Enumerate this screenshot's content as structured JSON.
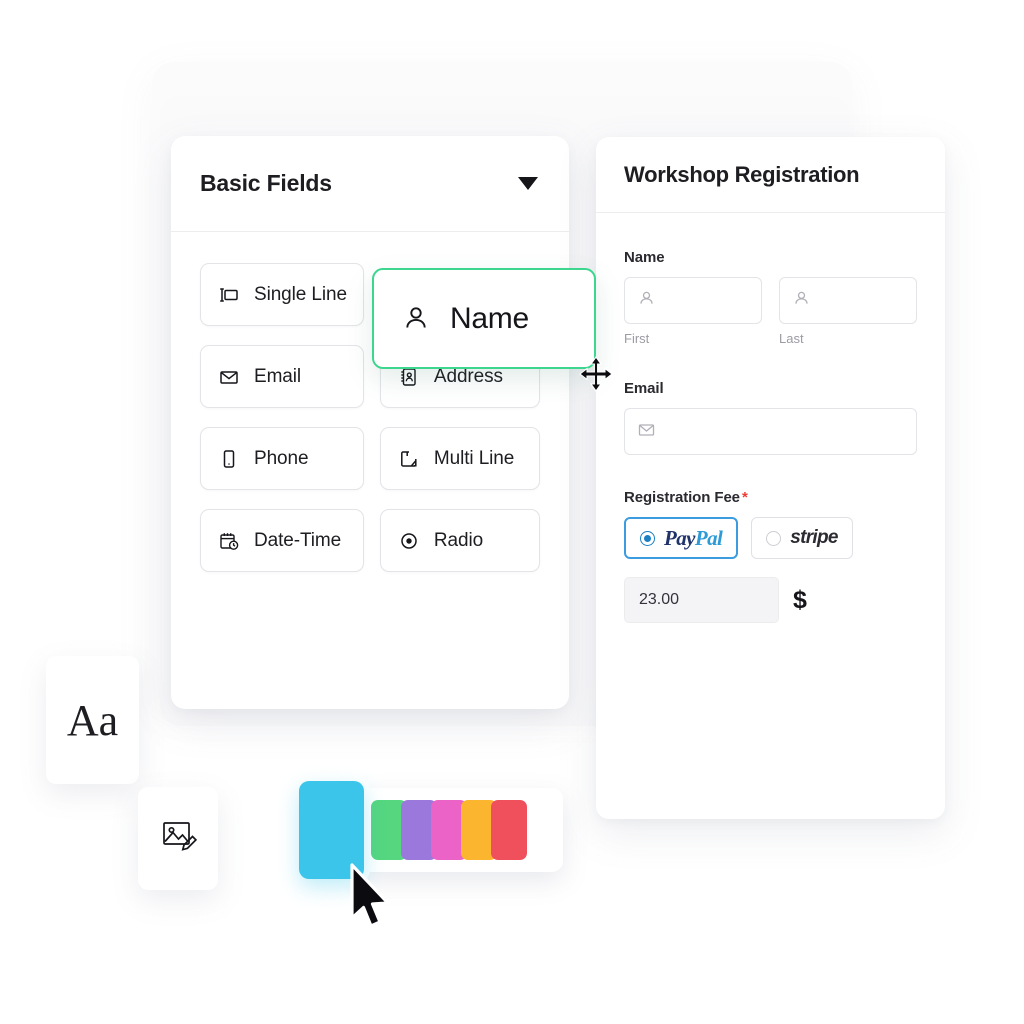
{
  "panels": {
    "fields": {
      "header_title": "Basic Fields",
      "chevron_icon": "chevron-down-icon",
      "items": [
        {
          "label": "Single Line",
          "icon": "single-line-icon"
        },
        {
          "label": "Email",
          "icon": "envelope-icon"
        },
        {
          "label": "Address",
          "icon": "address-book-icon"
        },
        {
          "label": "Phone",
          "icon": "phone-icon"
        },
        {
          "label": "Multi Line",
          "icon": "multi-line-icon"
        },
        {
          "label": "Date-Time",
          "icon": "calendar-clock-icon"
        },
        {
          "label": "Radio",
          "icon": "radio-button-icon"
        }
      ],
      "dragging_chip": {
        "label": "Name",
        "icon": "user-icon",
        "border_color": "#3cd68e",
        "state": "dragging"
      },
      "move_cursor_icon": "move-four-arrows-cursor"
    },
    "form": {
      "title": "Workshop Registration",
      "sections": [
        {
          "label": "Name",
          "required": false,
          "inputs": [
            {
              "icon": "user-icon",
              "value": "",
              "sub_label": "First"
            },
            {
              "icon": "user-icon",
              "value": "",
              "sub_label": "Last"
            }
          ]
        },
        {
          "label": "Email",
          "required": false,
          "inputs": [
            {
              "icon": "envelope-icon",
              "value": "",
              "sub_label": ""
            }
          ]
        }
      ],
      "payment": {
        "label": "Registration Fee",
        "required": true,
        "required_marker": "*",
        "required_color": "#ee3b35",
        "options": [
          {
            "name": "PayPal",
            "logo_part_1": "Pay",
            "logo_part_2": "Pal",
            "selected": true,
            "border_color": "#3b9ce0"
          },
          {
            "name": "stripe",
            "logo_part_1": "stripe",
            "logo_part_2": "",
            "selected": false,
            "border_color": "#e0e1e5"
          }
        ],
        "amount_value": "23.00",
        "currency_symbol": "$"
      }
    }
  },
  "tools": {
    "typography_card": {
      "label": "Aa",
      "icon": "typography-icon"
    },
    "image_card": {
      "icon": "image-edit-icon"
    }
  },
  "palette": {
    "active_swatch": {
      "name": "cyan",
      "color": "#3bc5ea",
      "selected": true
    },
    "swatches": [
      {
        "name": "green",
        "color": "#55d67f"
      },
      {
        "name": "purple",
        "color": "#9a78dc"
      },
      {
        "name": "pink",
        "color": "#ec63c8"
      },
      {
        "name": "orange",
        "color": "#fcb52e"
      },
      {
        "name": "red",
        "color": "#f0505c"
      }
    ]
  },
  "cursor": {
    "icon": "arrow-pointer-cursor"
  }
}
